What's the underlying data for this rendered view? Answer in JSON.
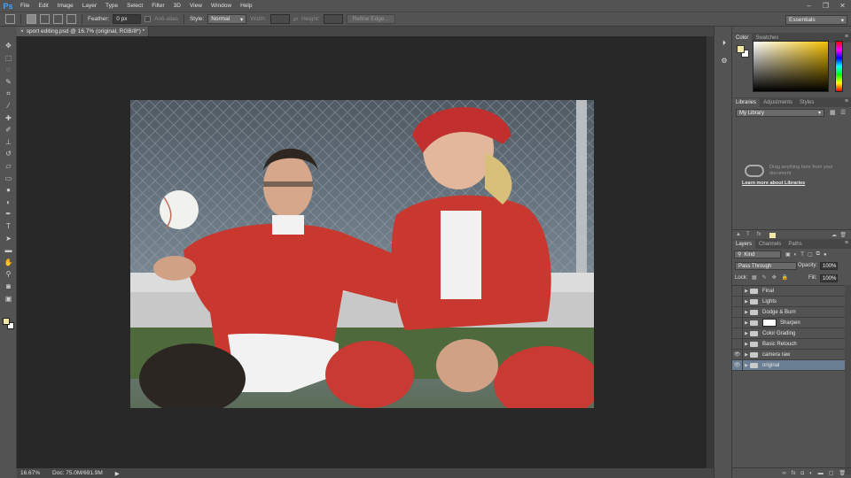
{
  "app": {
    "logo": "Ps"
  },
  "menu": [
    "File",
    "Edit",
    "Image",
    "Layer",
    "Type",
    "Select",
    "Filter",
    "3D",
    "View",
    "Window",
    "Help"
  ],
  "window_controls": {
    "minimize": "–",
    "maximize": "❐",
    "close": "✕"
  },
  "options_bar": {
    "feather_label": "Feather:",
    "feather_value": "0 px",
    "anti_alias_label": "Anti-alias",
    "style_label": "Style:",
    "style_value": "Normal",
    "width_label": "Width:",
    "height_label": "Height:",
    "refine_edge_label": "Refine Edge...",
    "workspace": "Essentials"
  },
  "document": {
    "tab_title": "sport editing.psd @ 16.7% (original, RGB/8*) *",
    "close_glyph": "×"
  },
  "status": {
    "zoom": "16.67%",
    "doc_info": "Doc: 75.0M/691.9M",
    "arrow": "▶"
  },
  "tools": [
    {
      "icon": "move-tool-icon",
      "glyph": "✥"
    },
    {
      "icon": "marquee-tool-icon",
      "glyph": "⬚"
    },
    {
      "icon": "lasso-tool-icon",
      "glyph": "◌"
    },
    {
      "icon": "quick-select-tool-icon",
      "glyph": "✎"
    },
    {
      "icon": "crop-tool-icon",
      "glyph": "⌗"
    },
    {
      "icon": "eyedropper-tool-icon",
      "glyph": "⁄"
    },
    {
      "icon": "healing-brush-tool-icon",
      "glyph": "✚"
    },
    {
      "icon": "brush-tool-icon",
      "glyph": "✐"
    },
    {
      "icon": "clone-stamp-tool-icon",
      "glyph": "⊥"
    },
    {
      "icon": "history-brush-tool-icon",
      "glyph": "↺"
    },
    {
      "icon": "eraser-tool-icon",
      "glyph": "▱"
    },
    {
      "icon": "gradient-tool-icon",
      "glyph": "▭"
    },
    {
      "icon": "blur-tool-icon",
      "glyph": "●"
    },
    {
      "icon": "dodge-tool-icon",
      "glyph": "◐"
    },
    {
      "icon": "pen-tool-icon",
      "glyph": "✒"
    },
    {
      "icon": "type-tool-icon",
      "glyph": "T"
    },
    {
      "icon": "path-select-tool-icon",
      "glyph": "➤"
    },
    {
      "icon": "rectangle-tool-icon",
      "glyph": "▬"
    },
    {
      "icon": "hand-tool-icon",
      "glyph": "✋"
    },
    {
      "icon": "zoom-tool-icon",
      "glyph": "⚲"
    },
    {
      "icon": "edit-in-quick-mask-icon",
      "glyph": "◙"
    },
    {
      "icon": "screen-mode-icon",
      "glyph": "▣"
    }
  ],
  "colors": {
    "foreground": "#f2e7a6",
    "background": "#ffffff",
    "selection_blue": "#6b7f94"
  },
  "panels": {
    "color_tabs": [
      {
        "label": "Color",
        "active": true
      },
      {
        "label": "Swatches",
        "active": false
      }
    ],
    "library_tabs": [
      {
        "label": "Libraries",
        "active": true
      },
      {
        "label": "Adjustments",
        "active": false
      },
      {
        "label": "Styles",
        "active": false
      }
    ],
    "library_select": "My Library",
    "library_hint": "Drag anything here from your document",
    "library_link": "Learn more about Libraries",
    "layers_tabs": [
      {
        "label": "Layers",
        "active": true
      },
      {
        "label": "Channels",
        "active": false
      },
      {
        "label": "Paths",
        "active": false
      }
    ],
    "layers_filter": "Kind",
    "blend_mode": "Pass Through",
    "opacity_label": "Opacity:",
    "opacity_value": "100%",
    "lock_label": "Lock:",
    "fill_label": "Fill:",
    "fill_value": "100%"
  },
  "layers": [
    {
      "name": "Final",
      "visible": false,
      "has_mask": false,
      "selected": false
    },
    {
      "name": "Lights",
      "visible": false,
      "has_mask": false,
      "selected": false
    },
    {
      "name": "Dodge & Burn",
      "visible": false,
      "has_mask": false,
      "selected": false
    },
    {
      "name": "Sharpen",
      "visible": false,
      "has_mask": true,
      "selected": false
    },
    {
      "name": "Color Grading",
      "visible": false,
      "has_mask": false,
      "selected": false
    },
    {
      "name": "Basic Retouch",
      "visible": false,
      "has_mask": false,
      "selected": false
    },
    {
      "name": "camera raw",
      "visible": true,
      "has_mask": false,
      "selected": false
    },
    {
      "name": "original",
      "visible": true,
      "has_mask": false,
      "selected": true
    }
  ]
}
